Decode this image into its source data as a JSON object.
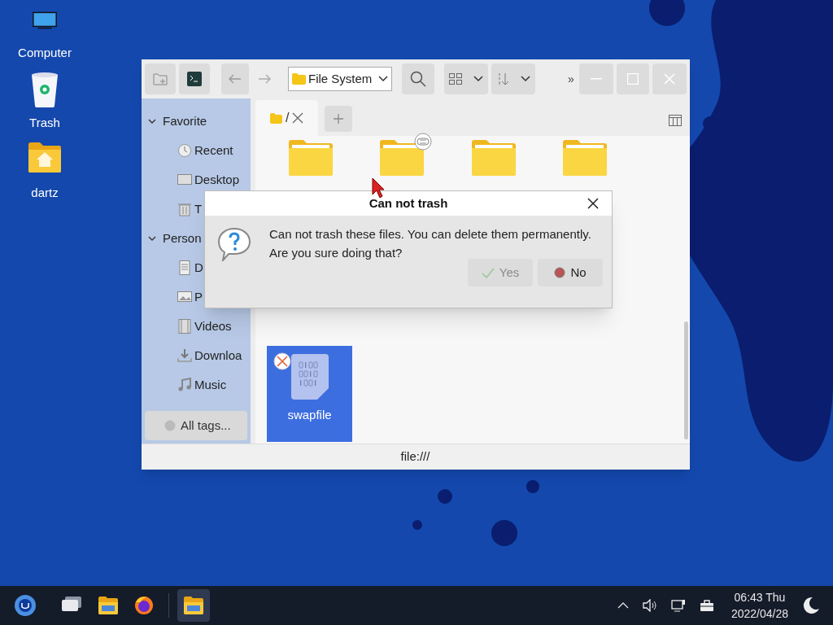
{
  "desktop_icons": [
    {
      "label": "Computer",
      "kind": "computer"
    },
    {
      "label": "Trash",
      "kind": "trash"
    },
    {
      "label": "dartz",
      "kind": "home"
    }
  ],
  "window": {
    "location": "File System",
    "overflow": "»",
    "tabs": [
      {
        "label": "/",
        "selected": true
      }
    ],
    "sidebar": [
      {
        "label": "Favorite",
        "expanded": true,
        "children": [
          {
            "label": "Recent",
            "kind": "recent"
          },
          {
            "label": "Desktop",
            "kind": "desktop"
          },
          {
            "label": "T",
            "kind": "trash"
          }
        ]
      },
      {
        "label": "Person",
        "expanded": true,
        "children": [
          {
            "label": "D",
            "kind": "document"
          },
          {
            "label": "P",
            "kind": "picture"
          },
          {
            "label": "Videos",
            "kind": "video"
          },
          {
            "label": "Downloa",
            "kind": "download"
          },
          {
            "label": "Music",
            "kind": "music"
          }
        ]
      }
    ],
    "all_tags_button": "All tags...",
    "files": [
      {
        "kind": "folder",
        "selected": false
      },
      {
        "kind": "folder",
        "selected": false,
        "linked": true
      },
      {
        "kind": "folder",
        "selected": false
      },
      {
        "kind": "folder",
        "selected": false
      },
      {
        "kind": "binary",
        "label": "swapfile",
        "selected": true,
        "unreadable": true
      }
    ],
    "status_bar": "file:///"
  },
  "dialog": {
    "title": "Can not trash",
    "message": "Can not trash these files. You can delete them permanently.\nAre you sure doing that?",
    "buttons": [
      {
        "label": "Yes",
        "kind": "confirm",
        "disabled": true
      },
      {
        "label": "No",
        "kind": "cancel",
        "disabled": false
      }
    ]
  },
  "taskbar": {
    "apps": [
      {
        "kind": "multitask",
        "active": false
      },
      {
        "kind": "files",
        "active": false
      },
      {
        "kind": "browser",
        "active": false
      },
      {
        "kind": "files",
        "active": true
      }
    ],
    "clock_time": "06:43 Thu",
    "clock_date": "2022/04/28"
  }
}
